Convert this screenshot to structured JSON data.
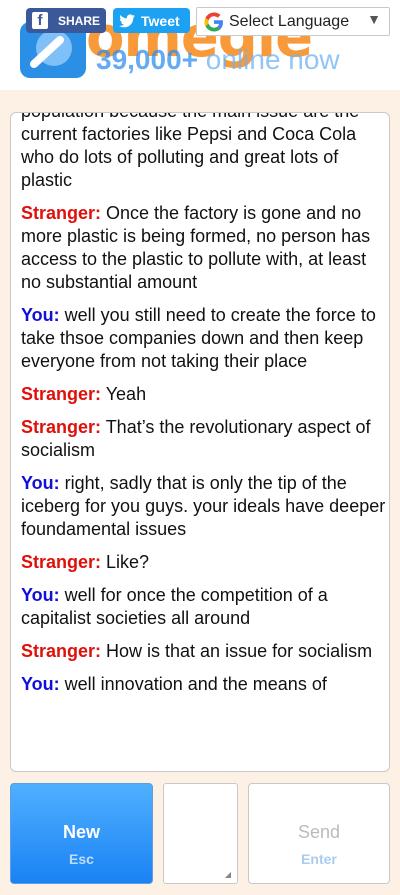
{
  "header": {
    "logo_text": "omegle",
    "online_count": "39,000+",
    "online_label": "online now",
    "share_label": "SHARE",
    "tweet_label": "Tweet",
    "language_label": "Select Language"
  },
  "chat": {
    "messages": [
      {
        "speaker": "",
        "text": "population because the main issue are the current factories like Pepsi and Coca Cola who do lots of polluting and great lots of plastic"
      },
      {
        "speaker": "Stranger:",
        "text": " Once the factory is gone and no more plastic is being formed, no person has access to the plastic to pollute with, at least no substantial amount"
      },
      {
        "speaker": "You:",
        "text": " well you still need to create the force to take thsoe companies down and then keep everyone from not taking their place"
      },
      {
        "speaker": "Stranger:",
        "text": " Yeah"
      },
      {
        "speaker": "Stranger:",
        "text": " That’s the revolutionary aspect of socialism"
      },
      {
        "speaker": "You:",
        "text": " right, sadly that is only the tip of the iceberg for you guys. your ideals have deeper foundamental issues"
      },
      {
        "speaker": "Stranger:",
        "text": " Like?"
      },
      {
        "speaker": "You:",
        "text": " well for once the competition of a capitalist societies all around"
      },
      {
        "speaker": "Stranger:",
        "text": " How is that an issue for socialism"
      },
      {
        "speaker": "You:",
        "text": " well innovation and the means of"
      }
    ]
  },
  "controls": {
    "new_label": "New",
    "new_shortcut": "Esc",
    "send_label": "Send",
    "send_shortcut": "Enter"
  },
  "colors": {
    "you": "#1010d8",
    "stranger": "#e0100a",
    "accent": "#1a82f4",
    "background": "#fdf1e6"
  }
}
